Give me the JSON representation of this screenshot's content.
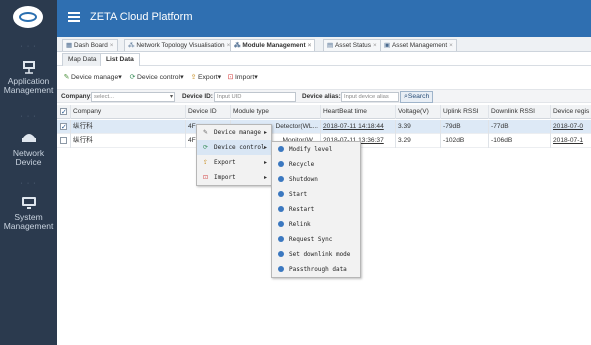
{
  "app": {
    "title": "ZETA Cloud Platform"
  },
  "colors": {
    "sidebar": "#2b3a4e",
    "header": "#2f6fb1",
    "selected_row": "#dde9f6"
  },
  "sidebar": {
    "items": [
      {
        "label_line1": "Application",
        "label_line2": "Management",
        "icon": "presentation-board-icon"
      },
      {
        "label_line1": "Network",
        "label_line2": "Device",
        "icon": "router-icon"
      },
      {
        "label_line1": "System",
        "label_line2": "Management",
        "icon": "monitor-icon"
      }
    ]
  },
  "tabs": [
    {
      "label": "Dash Board",
      "icon": "dashboard-icon"
    },
    {
      "label": "Network Topology Visualisation",
      "icon": "topology-icon"
    },
    {
      "label": "Module Management",
      "icon": "module-icon",
      "active": true
    },
    {
      "label": "Asset Status",
      "icon": "asset-status-icon"
    },
    {
      "label": "Asset Management",
      "icon": "asset-management-icon"
    }
  ],
  "subtabs": [
    {
      "label": "Map Data"
    },
    {
      "label": "List Data",
      "active": true
    }
  ],
  "toolbar": {
    "device_manage": "Device manage",
    "device_control": "Device control",
    "export": "Export",
    "import": "Import"
  },
  "filters": {
    "company_label": "Company:",
    "company_placeholder": "select...",
    "device_id_label": "Device ID:",
    "device_id_placeholder": "Input UID",
    "device_alias_label": "Device alias:",
    "device_alias_placeholder": "Input device alias",
    "search_label": "Search"
  },
  "grid": {
    "columns": [
      "Company",
      "Device ID",
      "Module type",
      "HeartBeat time",
      "Voltage(V)",
      "Uplink RSSI",
      "Downlink RSSI",
      "Device regis"
    ],
    "rows": [
      {
        "company": "纵行科",
        "device_id": "4F",
        "module_type": "Detector(WL...",
        "heartbeat": "2018-07-11 14:18:44",
        "voltage": "3.39",
        "uplink": "-79dB",
        "downlink": "-77dB",
        "registered": "2018-07-0",
        "checked": true
      },
      {
        "company": "纵行科",
        "device_id": "4F",
        "module_type": "Monitor(W...",
        "heartbeat": "2018-07-11 13:36:37",
        "voltage": "3.29",
        "uplink": "-102dB",
        "downlink": "-106dB",
        "registered": "2018-07-1",
        "checked": false
      }
    ]
  },
  "context_menu": {
    "items": [
      {
        "label": "Device manage",
        "icon": "device-manage-icon"
      },
      {
        "label": "Device control",
        "icon": "device-control-icon"
      },
      {
        "label": "Export",
        "icon": "export-icon"
      },
      {
        "label": "Import",
        "icon": "import-icon"
      }
    ]
  },
  "submenu": {
    "items": [
      "Modify level",
      "Recycle",
      "Shutdown",
      "Start",
      "Restart",
      "Relink",
      "Request Sync",
      "Set downlink mode",
      "Passthrough data"
    ]
  }
}
